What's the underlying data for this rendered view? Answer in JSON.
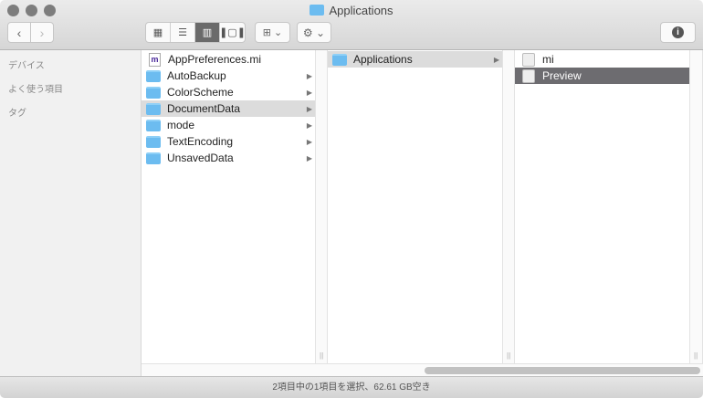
{
  "window": {
    "title": "Applications"
  },
  "toolbar": {
    "back": "‹",
    "forward": "›",
    "view_icon": "▦",
    "view_list": "☰",
    "view_column": "▥",
    "view_gallery": "❚▢❚",
    "arrange": "⊞ ⌄",
    "action": "⚙ ⌄",
    "info": "i"
  },
  "sidebar": {
    "sections": [
      "デバイス",
      "よく使う項目",
      "タグ"
    ]
  },
  "columns": [
    [
      {
        "name": "AppPreferences.mi",
        "type": "doc",
        "icon_letter": "m"
      },
      {
        "name": "AutoBackup",
        "type": "folder"
      },
      {
        "name": "ColorScheme",
        "type": "folder"
      },
      {
        "name": "DocumentData",
        "type": "folder",
        "selected": true
      },
      {
        "name": "mode",
        "type": "folder"
      },
      {
        "name": "TextEncoding",
        "type": "folder"
      },
      {
        "name": "UnsavedData",
        "type": "folder"
      }
    ],
    [
      {
        "name": "Applications",
        "type": "folder",
        "selected": true
      }
    ],
    [
      {
        "name": "mi",
        "type": "app"
      },
      {
        "name": "Preview",
        "type": "app",
        "highlighted": true
      }
    ]
  ],
  "status": {
    "text": "2項目中の1項目を選択、62.61 GB空き"
  },
  "resize_glyph": "||",
  "arrow_glyph": "▶"
}
